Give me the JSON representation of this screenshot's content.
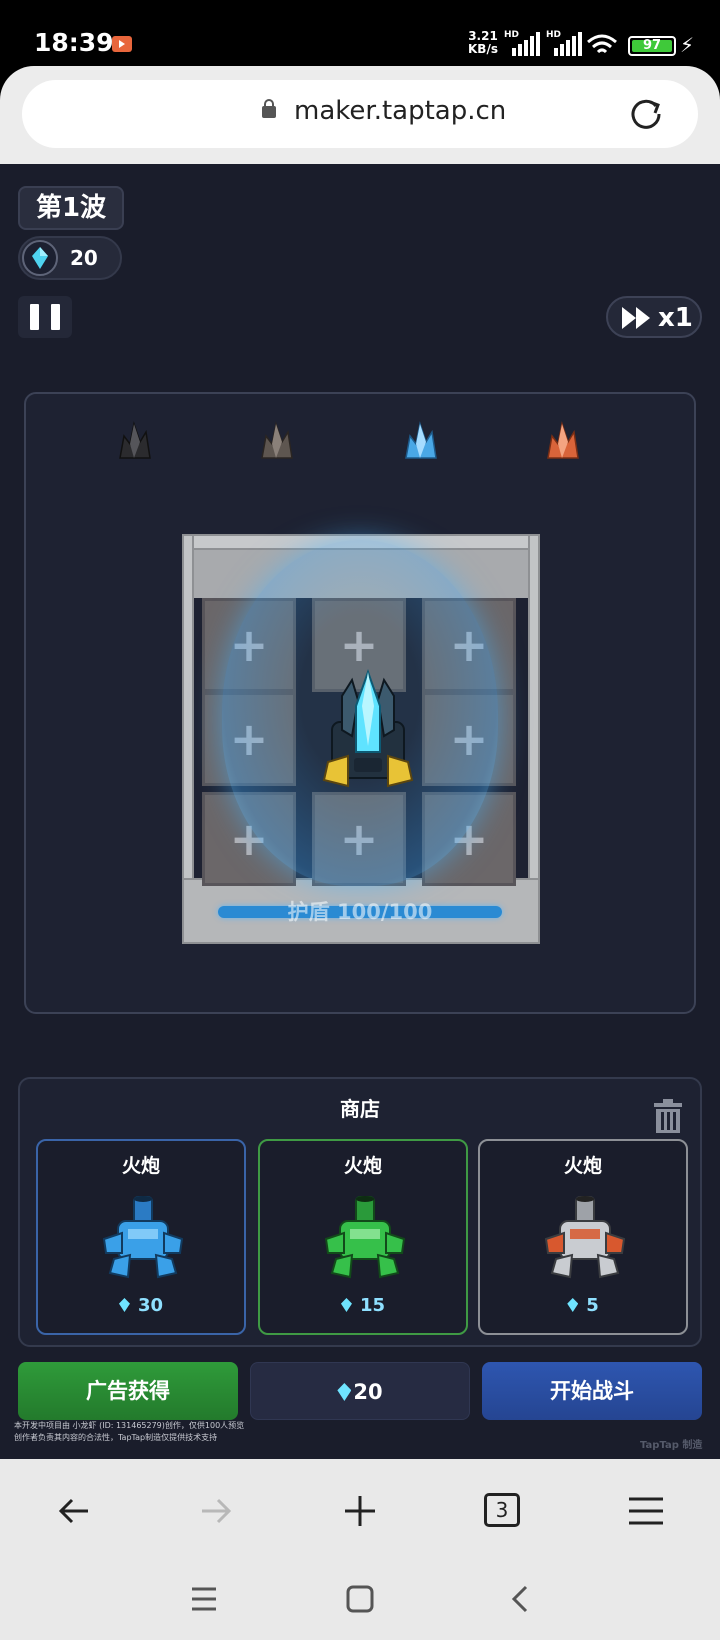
{
  "status_bar": {
    "time": "18:39",
    "net_speed_value": "3.21",
    "net_speed_unit": "KB/s",
    "hd1": "HD",
    "hd2": "HD",
    "battery": "97"
  },
  "browser": {
    "url": "maker.taptap.cn",
    "tab_count": "3"
  },
  "game": {
    "wave_label": "第1波",
    "gems": "20",
    "speed_label": "x1",
    "shield_text": "护盾 100/100",
    "crystal_colors": [
      "#2b2b2e",
      "#5e5650",
      "#4aa8e6",
      "#d9643a"
    ]
  },
  "shop": {
    "title": "商店",
    "items": [
      {
        "name": "火炮",
        "price": "30",
        "color": "#3aa0e8",
        "border": "#3a64a8"
      },
      {
        "name": "火炮",
        "price": "15",
        "color": "#36c04a",
        "border": "#3f9a44"
      },
      {
        "name": "火炮",
        "price": "5",
        "color": "#c9ccd1",
        "border": "#8d9096"
      }
    ]
  },
  "actions": {
    "ad_button": "广告获得",
    "gems_button": "20",
    "start_button": "开始战斗"
  },
  "footer": {
    "line1": "本开发中项目由 小龙虾 (ID: 131465279)创作，仅供100人预览",
    "line2": "创作者负责其内容的合法性，TapTap制造仅提供技术支持",
    "brand": "TapTap 制造"
  }
}
